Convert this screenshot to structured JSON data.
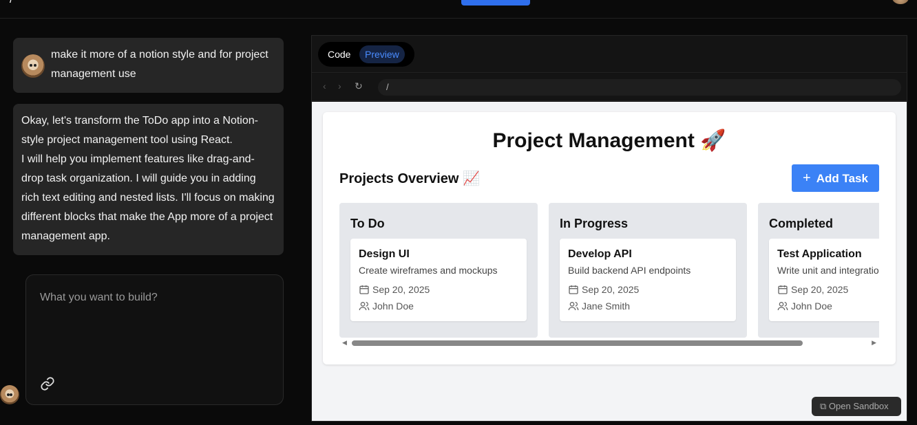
{
  "chat": {
    "user_message": "make it more of a notion style and for project management use",
    "assistant_message_lines": [
      "Okay, let's transform the ToDo app into a Notion-",
      "style project management tool using React.",
      "I will help you implement features like drag-and-",
      "drop task organization. I will guide you in adding",
      "rich text editing and nested lists. I'll focus on making",
      "different blocks that make the App more of a project",
      "management app."
    ],
    "composer_placeholder": "What you want to build?",
    "icons": {
      "attach": "link-icon"
    }
  },
  "panel": {
    "tabs": {
      "code": "Code",
      "preview": "Preview"
    },
    "url": "/",
    "open_sandbox": "Open Sandbox"
  },
  "app": {
    "title": "Project Management 🚀",
    "overview_title": "Projects Overview 📈",
    "add_task_label": "Add Task",
    "columns": [
      {
        "title": "To Do",
        "task": {
          "title": "Design UI",
          "desc": "Create wireframes and mockups",
          "date": "Sep 20, 2025",
          "assignee": "John Doe"
        }
      },
      {
        "title": "In Progress",
        "task": {
          "title": "Develop API",
          "desc": "Build backend API endpoints",
          "date": "Sep 20, 2025",
          "assignee": "Jane Smith"
        }
      },
      {
        "title": "Completed",
        "task": {
          "title": "Test Application",
          "desc": "Write unit and integratio",
          "date": "Sep 20, 2025",
          "assignee": "John Doe"
        }
      }
    ]
  },
  "colors": {
    "accent": "#3b82f6",
    "preview_tab": "#4a8cff"
  }
}
